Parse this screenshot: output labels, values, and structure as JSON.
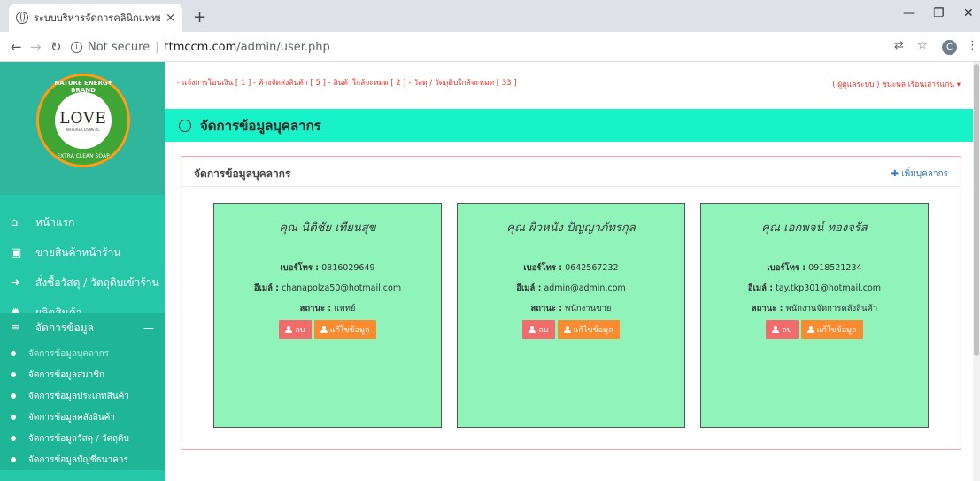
{
  "browser": {
    "tab_title": "ระบบบริหารจัดการคลินิกแพทย์แผนไทย",
    "tab_close": "×",
    "new_tab": "+",
    "not_secure": "Not secure",
    "url_host": "ttmccm.com",
    "url_path": "/admin/user.php",
    "profile_initial": "C"
  },
  "logo": {
    "word": "LOVE",
    "sub": "NATURE COSMETIC",
    "ring_top": "NATURE ENERGY BRAND",
    "ring_bottom": "EXTRA CLEAN SOAP"
  },
  "sidebar": {
    "items": [
      {
        "label": "หน้าแรก",
        "icon": "home-icon"
      },
      {
        "label": "ขายสินค้าหน้าร้าน",
        "icon": "cash-icon"
      },
      {
        "label": "สั่งซื้อวัสดุ / วัตถุดิบเข้าร้าน",
        "icon": "sign-in-icon"
      },
      {
        "label": "ผลิตสินค้า",
        "icon": "gear-icon"
      },
      {
        "label": "จัดการข้อมูล",
        "icon": "list-icon"
      }
    ],
    "sub_items": [
      {
        "label": "จัดการข้อมูลบุคลากร"
      },
      {
        "label": "จัดการข้อมูลสมาชิก"
      },
      {
        "label": "จัดการข้อมูลประเภทสินค้า"
      },
      {
        "label": "จัดการข้อมูลคลังสินค้า"
      },
      {
        "label": "จัดการข้อมูลวัสดุ / วัตถุดิบ"
      },
      {
        "label": "จัดการข้อมูลบัญชีธนาคาร"
      }
    ]
  },
  "topbar": {
    "alerts": "- แจ้งการโอนเงิน [ 1 ]   - ค้างจัดส่งสินค้า [ 5 ]   - สินค้าใกล้จะหมด [ 2 ]   - วัสดุ / วัตถุดิบใกล้จะหมด [ 33 ]",
    "user": "( ผู้ดูแลระบบ ) ชนะพล เรือนเสาร์แก่น ▾"
  },
  "page": {
    "title": "จัดการข้อมูลบุคลากร",
    "panel_title": "จัดการข้อมูลบุคลากร",
    "add_button": "✚ เพิ่มบุคลากร"
  },
  "labels": {
    "phone": "เบอร์โทร :",
    "email": "อีเมล์ :",
    "status": "สถานะ :",
    "delete": "ลบ",
    "edit": "แก้ไขข้อมูล"
  },
  "staff": [
    {
      "name": "คุณ นิติชัย เทียนสุข",
      "phone": "0816029649",
      "email": "chanapolza50@hotmail.com",
      "status": "แพทย์"
    },
    {
      "name": "คุณ ผิวหนัง ปัญญาภัทรกุล",
      "phone": "0642567232",
      "email": "admin@admin.com",
      "status": "พนักงานขาย"
    },
    {
      "name": "คุณ เอกพจน์ ทองจรัส",
      "phone": "0918521234",
      "email": "tay.tkp301@hotmail.com",
      "status": "พนักงานจัดการคลังสินค้า"
    }
  ]
}
